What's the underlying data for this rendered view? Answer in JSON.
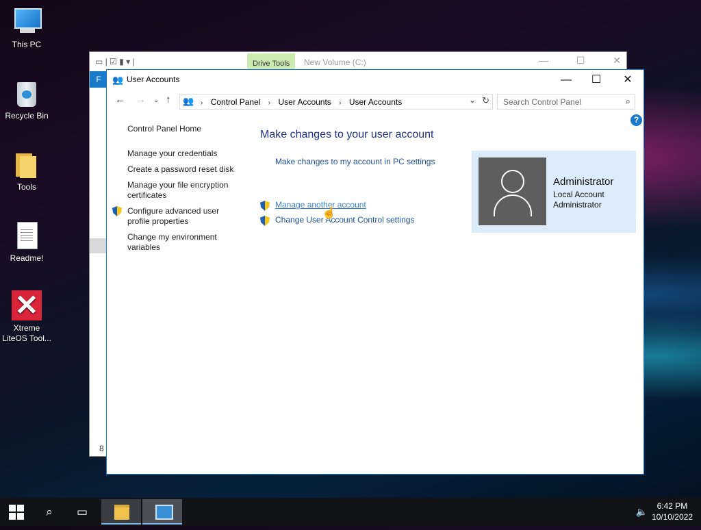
{
  "desktop": {
    "icons": [
      {
        "label": "This PC"
      },
      {
        "label": "Recycle Bin"
      },
      {
        "label": "Tools"
      },
      {
        "label": "Readme!"
      },
      {
        "label": "Xtreme LiteOS Tool..."
      }
    ]
  },
  "bg_window": {
    "tab": "Drive Tools",
    "title": "New Volume (C:)",
    "ribbon_letter": "F",
    "status": "8 i"
  },
  "window": {
    "title": "User Accounts",
    "breadcrumb": [
      "Control Panel",
      "User Accounts",
      "User Accounts"
    ],
    "search_placeholder": "Search Control Panel",
    "help": "?"
  },
  "sidebar": {
    "home": "Control Panel Home",
    "items": [
      "Manage your credentials",
      "Create a password reset disk",
      "Manage your file encryption certificates",
      "Configure advanced user profile properties",
      "Change my environment variables"
    ]
  },
  "main": {
    "heading": "Make changes to your user account",
    "pc_settings_link": "Make changes to my account in PC settings",
    "manage_link": "Manage another account",
    "uac_link": "Change User Account Control settings"
  },
  "account": {
    "name": "Administrator",
    "type": "Local Account",
    "role": "Administrator"
  },
  "taskbar": {
    "time": "6:42 PM",
    "date": "10/10/2022"
  }
}
